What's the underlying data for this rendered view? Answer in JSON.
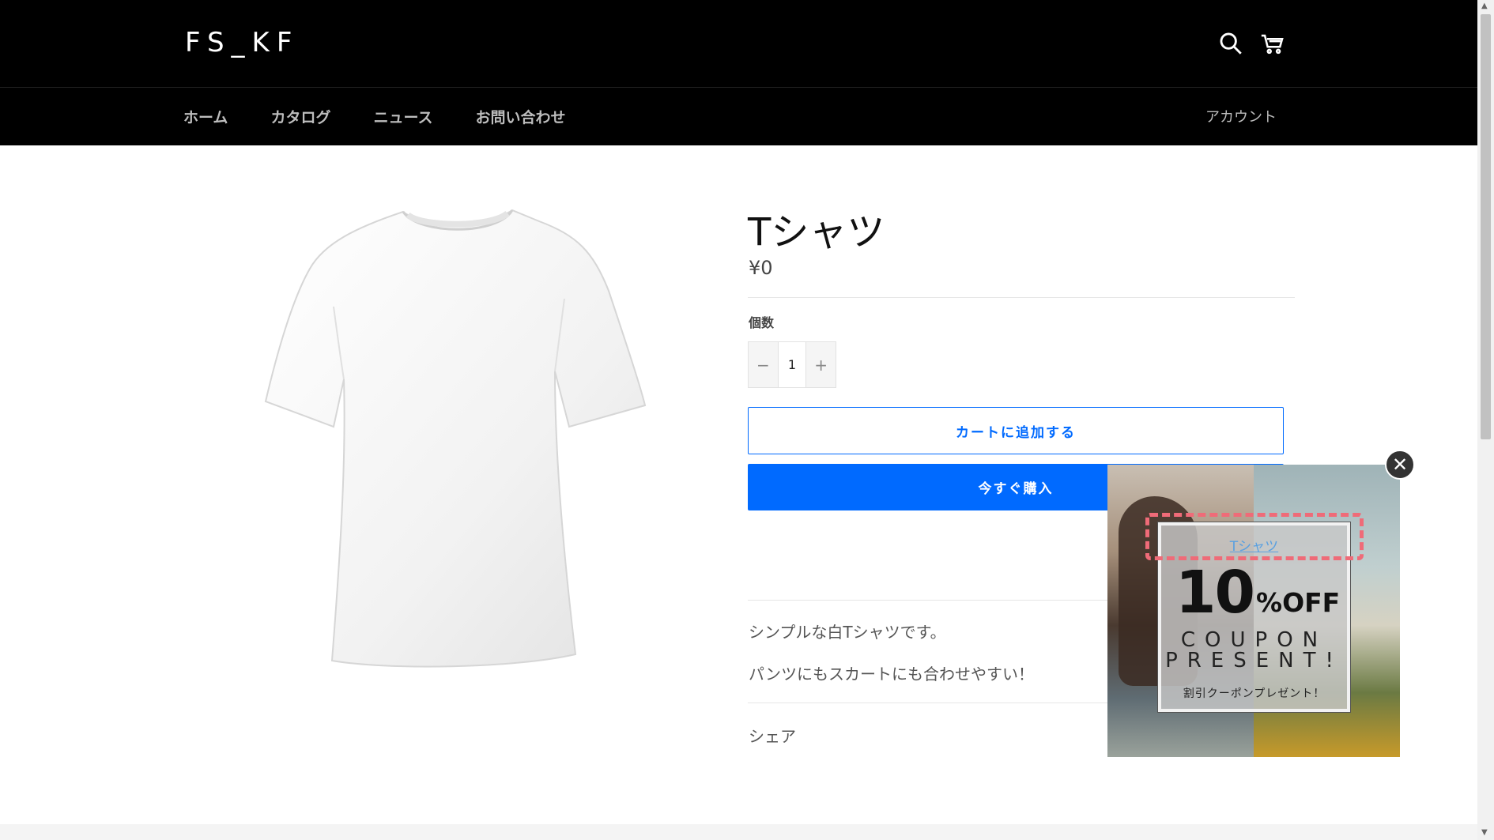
{
  "header": {
    "logo": "FS_KF",
    "icons": {
      "search": "search-icon",
      "cart": "cart-icon"
    },
    "nav": [
      "ホーム",
      "カタログ",
      "ニュース",
      "お問い合わせ"
    ],
    "account": "アカウント"
  },
  "product": {
    "title": "Tシャツ",
    "price": "¥0",
    "quantity_label": "個数",
    "quantity": {
      "minus": "−",
      "value": "1",
      "plus": "+"
    },
    "add_to_cart": "カートに追加する",
    "buy_now": "今すぐ購入",
    "description": [
      "シンプルな白Tシャツです。",
      "パンツにもスカートにも合わせやすい！"
    ],
    "share": "シェア"
  },
  "popup": {
    "link_text": "Tシャツ",
    "number": "10",
    "off": "%OFF",
    "line1": "COUPON",
    "line2": "PRESENT!",
    "subtext": "割引クーポンプレゼント！",
    "close": "✕"
  },
  "colors": {
    "accent": "#006aff",
    "header_bg": "#000000",
    "coupon_dash": "#ef6b78"
  }
}
